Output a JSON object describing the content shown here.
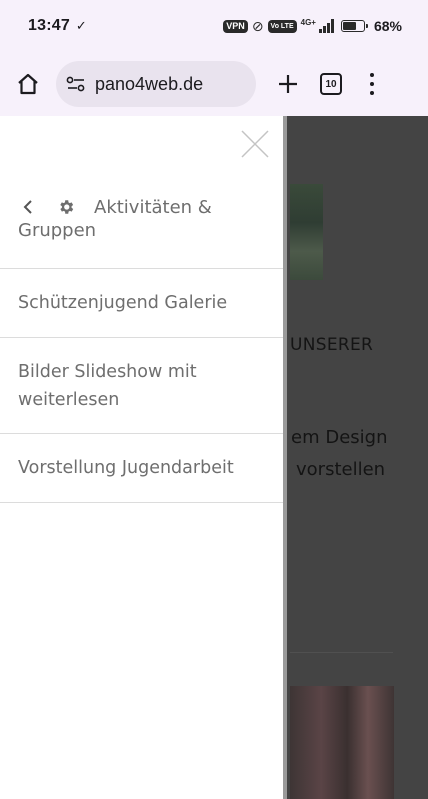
{
  "status": {
    "time": "13:47",
    "check": "✓",
    "vpn": "VPN",
    "volte": "Vo LTE",
    "network": "4G+",
    "battery": "68%",
    "battery_level": 0.68
  },
  "browser": {
    "url": "pano4web.de",
    "tab_count": "10"
  },
  "drawer": {
    "header_title_a": "Aktivitäten &",
    "header_title_b": "Gruppen",
    "items": [
      {
        "label": "Schützenjugend Galerie"
      },
      {
        "label_a": "Bilder Slideshow mit",
        "label_b": "weiterlesen"
      },
      {
        "label": "Vorstellung Jugendarbeit"
      }
    ]
  },
  "background": {
    "heading": "UNSERER",
    "line1": "em Design",
    "line2": "vorstellen"
  }
}
